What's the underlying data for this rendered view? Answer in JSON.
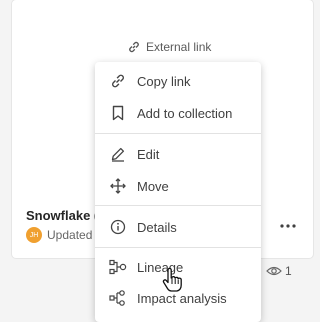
{
  "card": {
    "external_link_label": "External link",
    "title": "Snowflake (",
    "updated_label": "Updated",
    "avatar_initials": "JH",
    "views_count": "1"
  },
  "menu": {
    "items": [
      {
        "label": "Copy link",
        "icon": "link-icon"
      },
      {
        "label": "Add to collection",
        "icon": "bookmark-icon"
      },
      {
        "label": "Edit",
        "icon": "pencil-icon"
      },
      {
        "label": "Move",
        "icon": "move-icon"
      },
      {
        "label": "Details",
        "icon": "info-icon"
      },
      {
        "label": "Lineage",
        "icon": "lineage-icon"
      },
      {
        "label": "Impact analysis",
        "icon": "impact-analysis-icon"
      }
    ]
  },
  "colors": {
    "avatar": "#f0a030",
    "text": "#404040",
    "divider": "#e2e2e2"
  }
}
